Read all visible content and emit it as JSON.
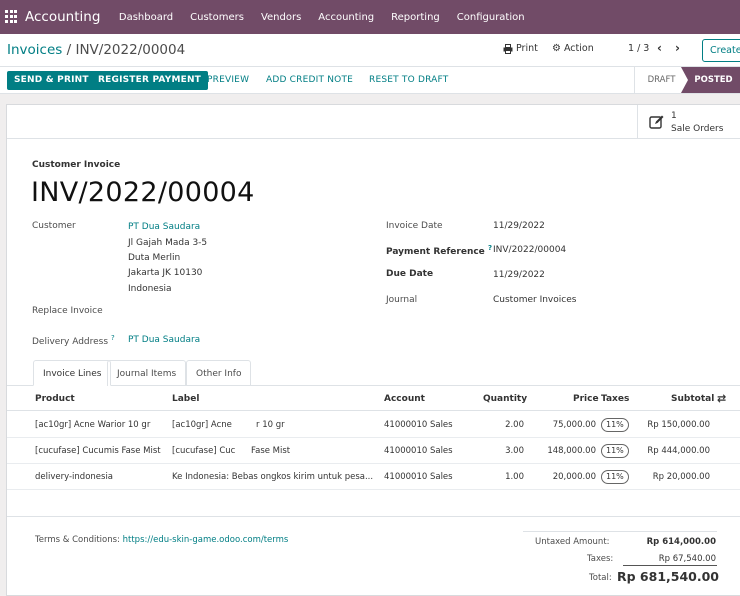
{
  "app": {
    "name": "Accounting"
  },
  "menu": [
    "Dashboard",
    "Customers",
    "Vendors",
    "Accounting",
    "Reporting",
    "Configuration"
  ],
  "breadcrumb": {
    "parent": "Invoices",
    "separator": "/",
    "current": "INV/2022/00004"
  },
  "toolbar": {
    "print": "Print",
    "action": "Action",
    "pager": "1 / 3",
    "create": "Create"
  },
  "statusbar": {
    "send_print": "SEND & PRINT",
    "register_payment": "REGISTER PAYMENT",
    "preview": "PREVIEW",
    "add_credit_note": "ADD CREDIT NOTE",
    "reset_to_draft": "RESET TO DRAFT",
    "stages": [
      "DRAFT",
      "POSTED"
    ],
    "active_stage": "POSTED"
  },
  "smart_button": {
    "count": "1",
    "label": "Sale Orders"
  },
  "invoice": {
    "type": "Customer Invoice",
    "name": "INV/2022/00004",
    "customer_label": "Customer",
    "customer_name": "PT Dua Saudara",
    "address": [
      "Jl Gajah Mada 3-5",
      "Duta Merlin",
      "Jakarta JK 10130",
      "Indonesia"
    ],
    "replace_invoice_label": "Replace Invoice",
    "delivery_address_label": "Delivery Address",
    "delivery_address_help": "?",
    "delivery_address": "PT Dua Saudara",
    "invoice_date_label": "Invoice Date",
    "invoice_date": "11/29/2022",
    "payment_reference_label": "Payment Reference",
    "payment_reference_help": "?",
    "payment_reference": "INV/2022/00004",
    "due_date_label": "Due Date",
    "due_date": "11/29/2022",
    "journal_label": "Journal",
    "journal": "Customer Invoices"
  },
  "tabs": [
    "Invoice Lines",
    "Journal Items",
    "Other Info"
  ],
  "table": {
    "headers": [
      "Product",
      "Label",
      "Account",
      "Quantity",
      "Price",
      "Taxes",
      "Subtotal"
    ],
    "rows": [
      {
        "product": "[ac10gr] Acne Warior 10 gr",
        "label_a": "[ac10gr] Acne",
        "label_b": "r 10 gr",
        "account": "41000010 Sales",
        "quantity": "2.00",
        "price": "75,000.00",
        "tax": "11%",
        "subtotal": "Rp 150,000.00"
      },
      {
        "product": "[cucufase] Cucumis Fase Mist",
        "label_a": "[cucufase] Cuc",
        "label_b": "Fase Mist",
        "account": "41000010 Sales",
        "quantity": "3.00",
        "price": "148,000.00",
        "tax": "11%",
        "subtotal": "Rp 444,000.00"
      },
      {
        "product": "delivery-indonesia",
        "label_a": "Ke Indonesia: Bebas ongkos kirim untuk pesa...",
        "label_b": "",
        "account": "41000010 Sales",
        "quantity": "1.00",
        "price": "20,000.00",
        "tax": "11%",
        "subtotal": "Rp 20,000.00"
      }
    ]
  },
  "terms": {
    "label": "Terms & Conditions:",
    "url": "https://edu-skin-game.odoo.com/terms"
  },
  "totals": {
    "untaxed_label": "Untaxed Amount:",
    "untaxed": "Rp 614,000.00",
    "taxes_label": "Taxes:",
    "taxes": "Rp 67,540.00",
    "total_label": "Total:",
    "total": "Rp 681,540.00"
  },
  "colors": {
    "brand": "#714b67",
    "accent": "#017e84"
  },
  "icons": [
    "apps-grid-icon",
    "print-icon",
    "gear-icon",
    "chevron-left-icon",
    "chevron-right-icon",
    "edit-icon",
    "column-settings-icon"
  ]
}
